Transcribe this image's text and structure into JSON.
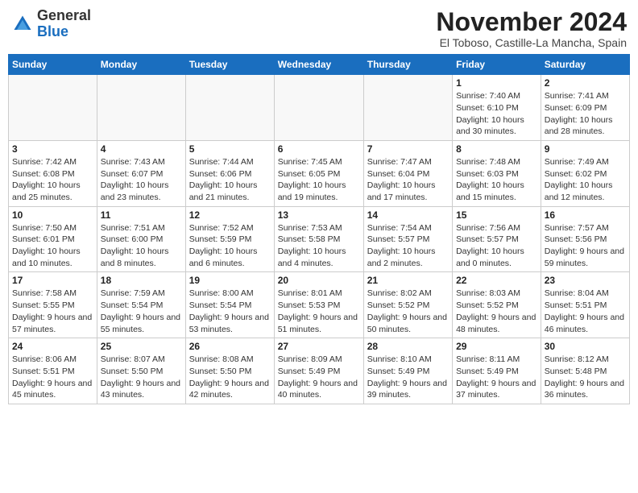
{
  "logo": {
    "general": "General",
    "blue": "Blue"
  },
  "header": {
    "month": "November 2024",
    "location": "El Toboso, Castille-La Mancha, Spain"
  },
  "weekdays": [
    "Sunday",
    "Monday",
    "Tuesday",
    "Wednesday",
    "Thursday",
    "Friday",
    "Saturday"
  ],
  "weeks": [
    [
      {
        "day": "",
        "info": ""
      },
      {
        "day": "",
        "info": ""
      },
      {
        "day": "",
        "info": ""
      },
      {
        "day": "",
        "info": ""
      },
      {
        "day": "",
        "info": ""
      },
      {
        "day": "1",
        "info": "Sunrise: 7:40 AM\nSunset: 6:10 PM\nDaylight: 10 hours and 30 minutes."
      },
      {
        "day": "2",
        "info": "Sunrise: 7:41 AM\nSunset: 6:09 PM\nDaylight: 10 hours and 28 minutes."
      }
    ],
    [
      {
        "day": "3",
        "info": "Sunrise: 7:42 AM\nSunset: 6:08 PM\nDaylight: 10 hours and 25 minutes."
      },
      {
        "day": "4",
        "info": "Sunrise: 7:43 AM\nSunset: 6:07 PM\nDaylight: 10 hours and 23 minutes."
      },
      {
        "day": "5",
        "info": "Sunrise: 7:44 AM\nSunset: 6:06 PM\nDaylight: 10 hours and 21 minutes."
      },
      {
        "day": "6",
        "info": "Sunrise: 7:45 AM\nSunset: 6:05 PM\nDaylight: 10 hours and 19 minutes."
      },
      {
        "day": "7",
        "info": "Sunrise: 7:47 AM\nSunset: 6:04 PM\nDaylight: 10 hours and 17 minutes."
      },
      {
        "day": "8",
        "info": "Sunrise: 7:48 AM\nSunset: 6:03 PM\nDaylight: 10 hours and 15 minutes."
      },
      {
        "day": "9",
        "info": "Sunrise: 7:49 AM\nSunset: 6:02 PM\nDaylight: 10 hours and 12 minutes."
      }
    ],
    [
      {
        "day": "10",
        "info": "Sunrise: 7:50 AM\nSunset: 6:01 PM\nDaylight: 10 hours and 10 minutes."
      },
      {
        "day": "11",
        "info": "Sunrise: 7:51 AM\nSunset: 6:00 PM\nDaylight: 10 hours and 8 minutes."
      },
      {
        "day": "12",
        "info": "Sunrise: 7:52 AM\nSunset: 5:59 PM\nDaylight: 10 hours and 6 minutes."
      },
      {
        "day": "13",
        "info": "Sunrise: 7:53 AM\nSunset: 5:58 PM\nDaylight: 10 hours and 4 minutes."
      },
      {
        "day": "14",
        "info": "Sunrise: 7:54 AM\nSunset: 5:57 PM\nDaylight: 10 hours and 2 minutes."
      },
      {
        "day": "15",
        "info": "Sunrise: 7:56 AM\nSunset: 5:57 PM\nDaylight: 10 hours and 0 minutes."
      },
      {
        "day": "16",
        "info": "Sunrise: 7:57 AM\nSunset: 5:56 PM\nDaylight: 9 hours and 59 minutes."
      }
    ],
    [
      {
        "day": "17",
        "info": "Sunrise: 7:58 AM\nSunset: 5:55 PM\nDaylight: 9 hours and 57 minutes."
      },
      {
        "day": "18",
        "info": "Sunrise: 7:59 AM\nSunset: 5:54 PM\nDaylight: 9 hours and 55 minutes."
      },
      {
        "day": "19",
        "info": "Sunrise: 8:00 AM\nSunset: 5:54 PM\nDaylight: 9 hours and 53 minutes."
      },
      {
        "day": "20",
        "info": "Sunrise: 8:01 AM\nSunset: 5:53 PM\nDaylight: 9 hours and 51 minutes."
      },
      {
        "day": "21",
        "info": "Sunrise: 8:02 AM\nSunset: 5:52 PM\nDaylight: 9 hours and 50 minutes."
      },
      {
        "day": "22",
        "info": "Sunrise: 8:03 AM\nSunset: 5:52 PM\nDaylight: 9 hours and 48 minutes."
      },
      {
        "day": "23",
        "info": "Sunrise: 8:04 AM\nSunset: 5:51 PM\nDaylight: 9 hours and 46 minutes."
      }
    ],
    [
      {
        "day": "24",
        "info": "Sunrise: 8:06 AM\nSunset: 5:51 PM\nDaylight: 9 hours and 45 minutes."
      },
      {
        "day": "25",
        "info": "Sunrise: 8:07 AM\nSunset: 5:50 PM\nDaylight: 9 hours and 43 minutes."
      },
      {
        "day": "26",
        "info": "Sunrise: 8:08 AM\nSunset: 5:50 PM\nDaylight: 9 hours and 42 minutes."
      },
      {
        "day": "27",
        "info": "Sunrise: 8:09 AM\nSunset: 5:49 PM\nDaylight: 9 hours and 40 minutes."
      },
      {
        "day": "28",
        "info": "Sunrise: 8:10 AM\nSunset: 5:49 PM\nDaylight: 9 hours and 39 minutes."
      },
      {
        "day": "29",
        "info": "Sunrise: 8:11 AM\nSunset: 5:49 PM\nDaylight: 9 hours and 37 minutes."
      },
      {
        "day": "30",
        "info": "Sunrise: 8:12 AM\nSunset: 5:48 PM\nDaylight: 9 hours and 36 minutes."
      }
    ]
  ]
}
